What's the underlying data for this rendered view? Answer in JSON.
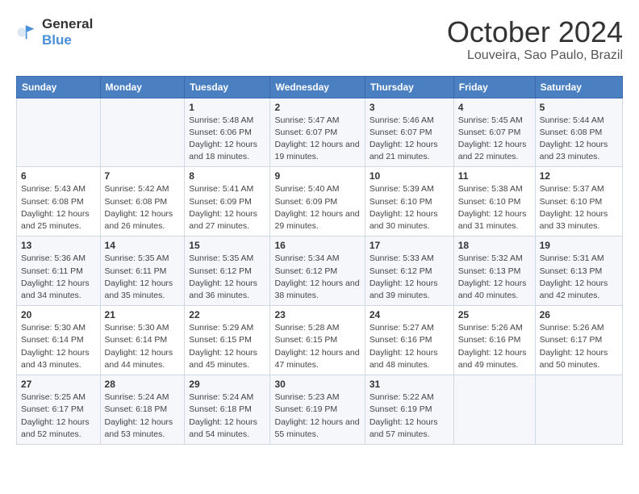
{
  "logo": {
    "line1": "General",
    "line2": "Blue"
  },
  "title": "October 2024",
  "location": "Louveira, Sao Paulo, Brazil",
  "weekdays": [
    "Sunday",
    "Monday",
    "Tuesday",
    "Wednesday",
    "Thursday",
    "Friday",
    "Saturday"
  ],
  "weeks": [
    [
      null,
      null,
      {
        "day": 1,
        "sunrise": "5:48 AM",
        "sunset": "6:06 PM",
        "daylight": "12 hours and 18 minutes."
      },
      {
        "day": 2,
        "sunrise": "5:47 AM",
        "sunset": "6:07 PM",
        "daylight": "12 hours and 19 minutes."
      },
      {
        "day": 3,
        "sunrise": "5:46 AM",
        "sunset": "6:07 PM",
        "daylight": "12 hours and 21 minutes."
      },
      {
        "day": 4,
        "sunrise": "5:45 AM",
        "sunset": "6:07 PM",
        "daylight": "12 hours and 22 minutes."
      },
      {
        "day": 5,
        "sunrise": "5:44 AM",
        "sunset": "6:08 PM",
        "daylight": "12 hours and 23 minutes."
      }
    ],
    [
      {
        "day": 6,
        "sunrise": "5:43 AM",
        "sunset": "6:08 PM",
        "daylight": "12 hours and 25 minutes."
      },
      {
        "day": 7,
        "sunrise": "5:42 AM",
        "sunset": "6:08 PM",
        "daylight": "12 hours and 26 minutes."
      },
      {
        "day": 8,
        "sunrise": "5:41 AM",
        "sunset": "6:09 PM",
        "daylight": "12 hours and 27 minutes."
      },
      {
        "day": 9,
        "sunrise": "5:40 AM",
        "sunset": "6:09 PM",
        "daylight": "12 hours and 29 minutes."
      },
      {
        "day": 10,
        "sunrise": "5:39 AM",
        "sunset": "6:10 PM",
        "daylight": "12 hours and 30 minutes."
      },
      {
        "day": 11,
        "sunrise": "5:38 AM",
        "sunset": "6:10 PM",
        "daylight": "12 hours and 31 minutes."
      },
      {
        "day": 12,
        "sunrise": "5:37 AM",
        "sunset": "6:10 PM",
        "daylight": "12 hours and 33 minutes."
      }
    ],
    [
      {
        "day": 13,
        "sunrise": "5:36 AM",
        "sunset": "6:11 PM",
        "daylight": "12 hours and 34 minutes."
      },
      {
        "day": 14,
        "sunrise": "5:35 AM",
        "sunset": "6:11 PM",
        "daylight": "12 hours and 35 minutes."
      },
      {
        "day": 15,
        "sunrise": "5:35 AM",
        "sunset": "6:12 PM",
        "daylight": "12 hours and 36 minutes."
      },
      {
        "day": 16,
        "sunrise": "5:34 AM",
        "sunset": "6:12 PM",
        "daylight": "12 hours and 38 minutes."
      },
      {
        "day": 17,
        "sunrise": "5:33 AM",
        "sunset": "6:12 PM",
        "daylight": "12 hours and 39 minutes."
      },
      {
        "day": 18,
        "sunrise": "5:32 AM",
        "sunset": "6:13 PM",
        "daylight": "12 hours and 40 minutes."
      },
      {
        "day": 19,
        "sunrise": "5:31 AM",
        "sunset": "6:13 PM",
        "daylight": "12 hours and 42 minutes."
      }
    ],
    [
      {
        "day": 20,
        "sunrise": "5:30 AM",
        "sunset": "6:14 PM",
        "daylight": "12 hours and 43 minutes."
      },
      {
        "day": 21,
        "sunrise": "5:30 AM",
        "sunset": "6:14 PM",
        "daylight": "12 hours and 44 minutes."
      },
      {
        "day": 22,
        "sunrise": "5:29 AM",
        "sunset": "6:15 PM",
        "daylight": "12 hours and 45 minutes."
      },
      {
        "day": 23,
        "sunrise": "5:28 AM",
        "sunset": "6:15 PM",
        "daylight": "12 hours and 47 minutes."
      },
      {
        "day": 24,
        "sunrise": "5:27 AM",
        "sunset": "6:16 PM",
        "daylight": "12 hours and 48 minutes."
      },
      {
        "day": 25,
        "sunrise": "5:26 AM",
        "sunset": "6:16 PM",
        "daylight": "12 hours and 49 minutes."
      },
      {
        "day": 26,
        "sunrise": "5:26 AM",
        "sunset": "6:17 PM",
        "daylight": "12 hours and 50 minutes."
      }
    ],
    [
      {
        "day": 27,
        "sunrise": "5:25 AM",
        "sunset": "6:17 PM",
        "daylight": "12 hours and 52 minutes."
      },
      {
        "day": 28,
        "sunrise": "5:24 AM",
        "sunset": "6:18 PM",
        "daylight": "12 hours and 53 minutes."
      },
      {
        "day": 29,
        "sunrise": "5:24 AM",
        "sunset": "6:18 PM",
        "daylight": "12 hours and 54 minutes."
      },
      {
        "day": 30,
        "sunrise": "5:23 AM",
        "sunset": "6:19 PM",
        "daylight": "12 hours and 55 minutes."
      },
      {
        "day": 31,
        "sunrise": "5:22 AM",
        "sunset": "6:19 PM",
        "daylight": "12 hours and 57 minutes."
      },
      null,
      null
    ]
  ]
}
